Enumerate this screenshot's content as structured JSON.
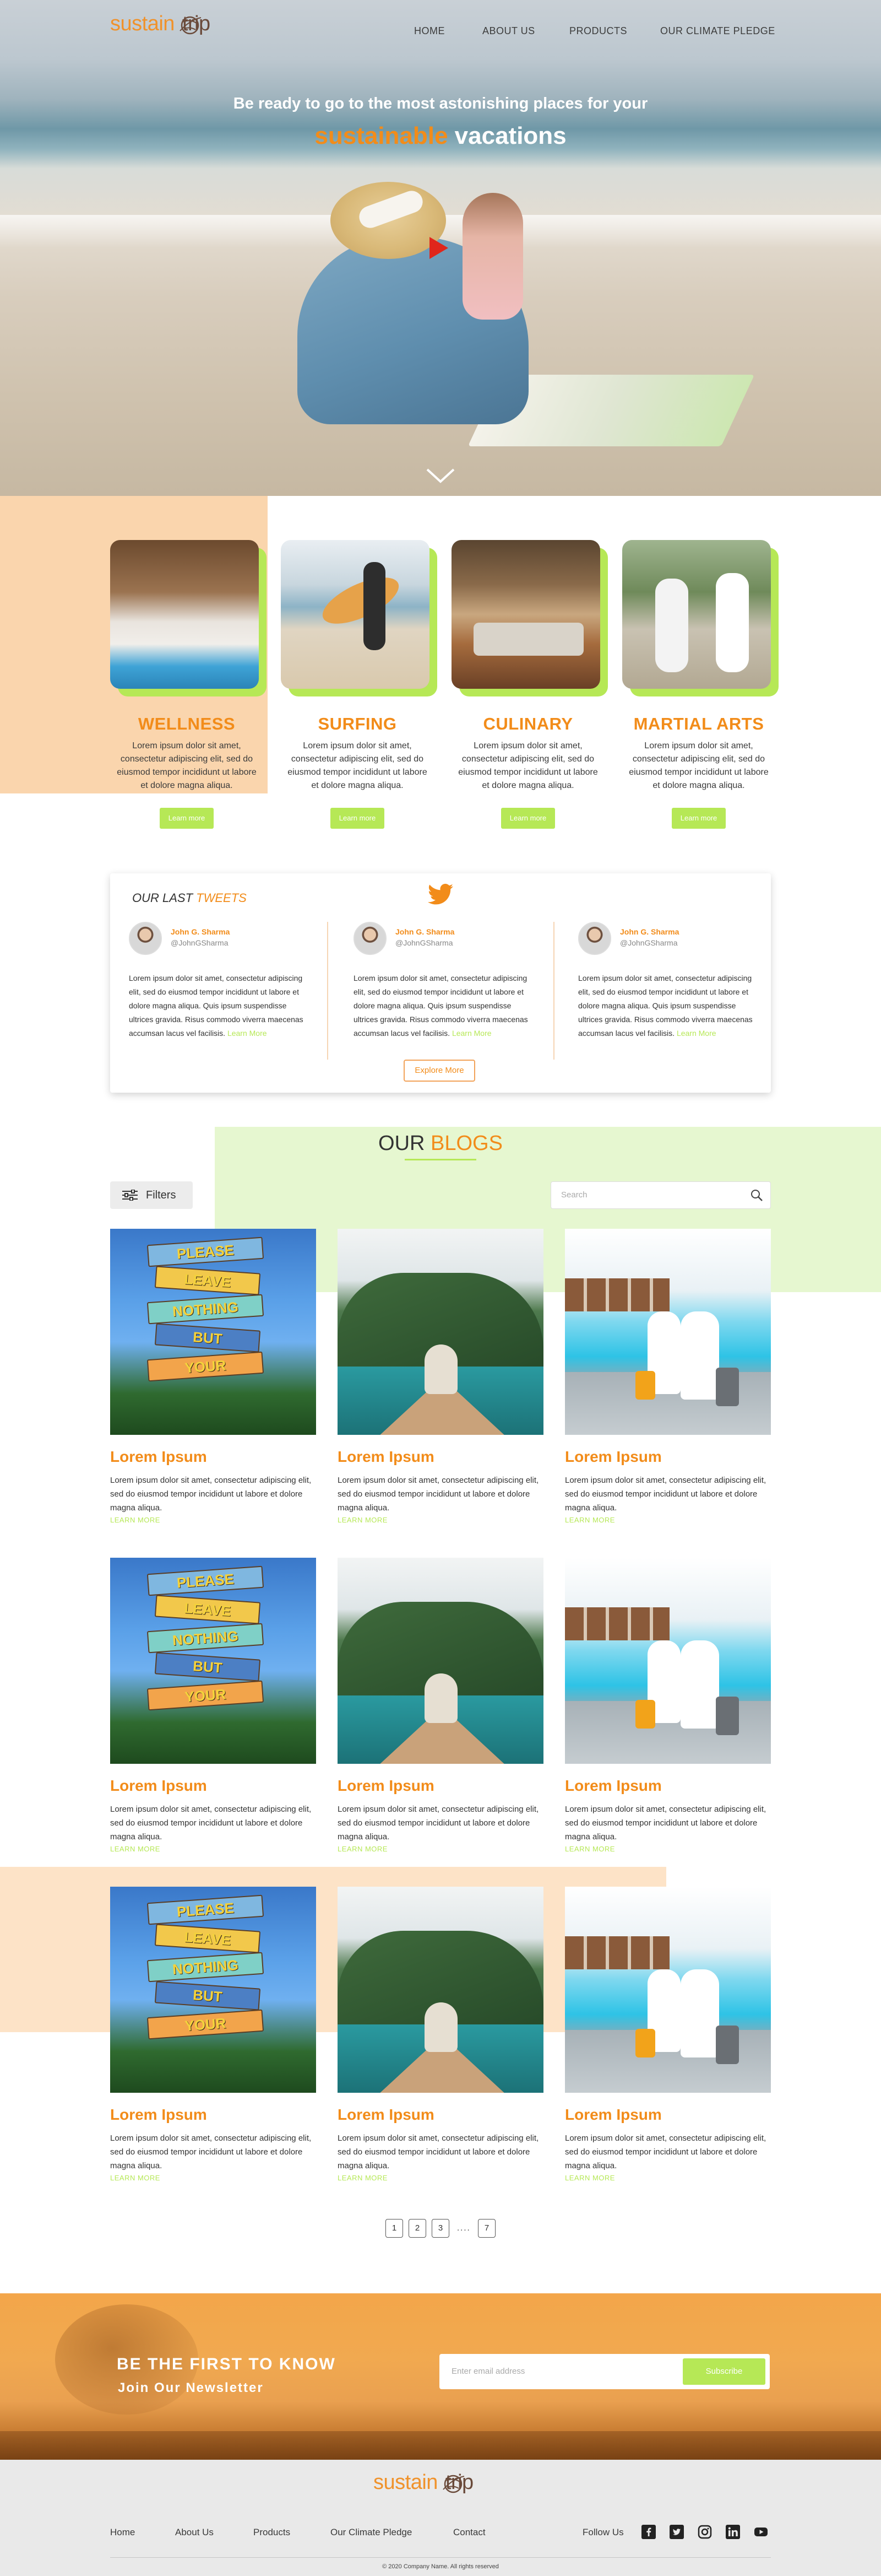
{
  "brand": {
    "logo_part1": "sustain",
    "logo_part2": "trip",
    "accent": "#f28c1a",
    "lime": "#b6e856"
  },
  "nav": {
    "items": [
      "HOME",
      "ABOUT US",
      "PRODUCTS",
      "OUR CLIMATE PLEDGE"
    ]
  },
  "hero": {
    "line1": "Be ready to go to the most astonishing places for your",
    "highlight": "sustainable",
    "line2_rest": " vacations",
    "play_icon": "play-icon",
    "scroll_icon": "chevron-down-icon"
  },
  "categories": [
    {
      "title": "WELLNESS",
      "text": "Lorem ipsum dolor sit amet, consectetur adipiscing elit, sed do eiusmod tempor incididunt ut labore et dolore magna aliqua.",
      "button": "Learn more"
    },
    {
      "title": "SURFING",
      "text": "Lorem ipsum dolor sit amet, consectetur adipiscing elit, sed do eiusmod tempor incididunt ut labore et dolore magna aliqua.",
      "button": "Learn more"
    },
    {
      "title": "CULINARY",
      "text": "Lorem ipsum dolor sit amet, consectetur adipiscing elit, sed do eiusmod tempor incididunt ut labore et dolore magna aliqua.",
      "button": "Learn more"
    },
    {
      "title": "MARTIAL ARTS",
      "text": "Lorem ipsum dolor sit amet, consectetur adipiscing elit, sed do eiusmod tempor incididunt ut labore et dolore magna aliqua.",
      "button": "Learn more"
    }
  ],
  "tweets": {
    "heading_prefix": "OUR LAST ",
    "heading_highlight": "TWEETS",
    "items": [
      {
        "name": "John G. Sharma",
        "handle": "@JohnGSharma",
        "text": "Lorem ipsum dolor sit amet, consectetur adipiscing elit, sed do eiusmod tempor incididunt ut labore et dolore magna aliqua. Quis ipsum suspendisse ultrices gravida. Risus commodo viverra maecenas accumsan lacus vel facilisis.",
        "link": "Learn More"
      },
      {
        "name": "John G. Sharma",
        "handle": "@JohnGSharma",
        "text": "Lorem ipsum dolor sit amet, consectetur adipiscing elit, sed do eiusmod tempor incididunt ut labore et dolore magna aliqua. Quis ipsum suspendisse ultrices gravida. Risus commodo viverra maecenas accumsan lacus vel facilisis.",
        "link": "Learn More"
      },
      {
        "name": "John G. Sharma",
        "handle": "@JohnGSharma",
        "text": "Lorem ipsum dolor sit amet, consectetur adipiscing elit, sed do eiusmod tempor incididunt ut labore et dolore magna aliqua. Quis ipsum suspendisse ultrices gravida. Risus commodo viverra maecenas accumsan lacus vel facilisis.",
        "link": "Learn More"
      }
    ],
    "explore": "Explore More"
  },
  "blogs": {
    "title_prefix": "OUR ",
    "title_highlight": "BLOGS",
    "filters": "Filters",
    "search_placeholder": "Search",
    "card_title": "Lorem Ipsum",
    "card_text": "Lorem ipsum dolor sit amet, consectetur adipiscing elit, sed do eiusmod tempor incididunt ut labore et dolore magna aliqua.",
    "card_link": "LEARN MORE",
    "sign_words": [
      "PLEASE",
      "LEAVE",
      "NOTHING",
      "BUT",
      "YOUR"
    ]
  },
  "pagination": {
    "pages": [
      "1",
      "2",
      "3"
    ],
    "ellipsis": "....",
    "last": "7"
  },
  "newsletter": {
    "title": "BE THE FIRST TO KNOW",
    "subtitle": "Join Our Newsletter",
    "placeholder": "Enter email address",
    "button": "Subscribe"
  },
  "footer": {
    "links": [
      "Home",
      "About Us",
      "Products",
      "Our Climate Pledge",
      "Contact"
    ],
    "follow": "Follow Us",
    "social": [
      "facebook-icon",
      "twitter-icon",
      "instagram-icon",
      "linkedin-icon",
      "youtube-icon"
    ],
    "copyright": "© 2020 Company Name. All rights reserved"
  }
}
